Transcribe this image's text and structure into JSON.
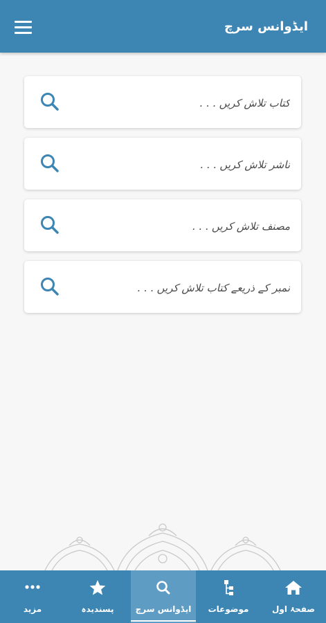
{
  "header": {
    "title": "ایڈوانس سرچ",
    "menu_icon": "hamburger-menu-icon"
  },
  "search_fields": [
    {
      "placeholder": "کتاب تلاش کریں . . .",
      "icon": "search-icon"
    },
    {
      "placeholder": "ناشر تلاش کریں . . .",
      "icon": "search-icon"
    },
    {
      "placeholder": "مصنف تلاش کریں . . .",
      "icon": "search-icon"
    },
    {
      "placeholder": "نمبر کے ذریعے کتاب تلاش کریں . . .",
      "icon": "search-icon"
    }
  ],
  "bottom_nav": {
    "items": [
      {
        "label": "مزید",
        "icon": "more-dots-icon"
      },
      {
        "label": "پسندیدہ",
        "icon": "star-icon"
      },
      {
        "label": "ایڈوانس سرچ",
        "icon": "search-icon",
        "active": true
      },
      {
        "label": "موضوعات",
        "icon": "topics-tree-icon"
      },
      {
        "label": "صفحۂ اول",
        "icon": "home-icon"
      }
    ]
  },
  "colors": {
    "primary": "#3d86b4",
    "active_tab": "#5e9cc4",
    "search_icon": "#3d86b4",
    "background": "#f7f7f7"
  }
}
